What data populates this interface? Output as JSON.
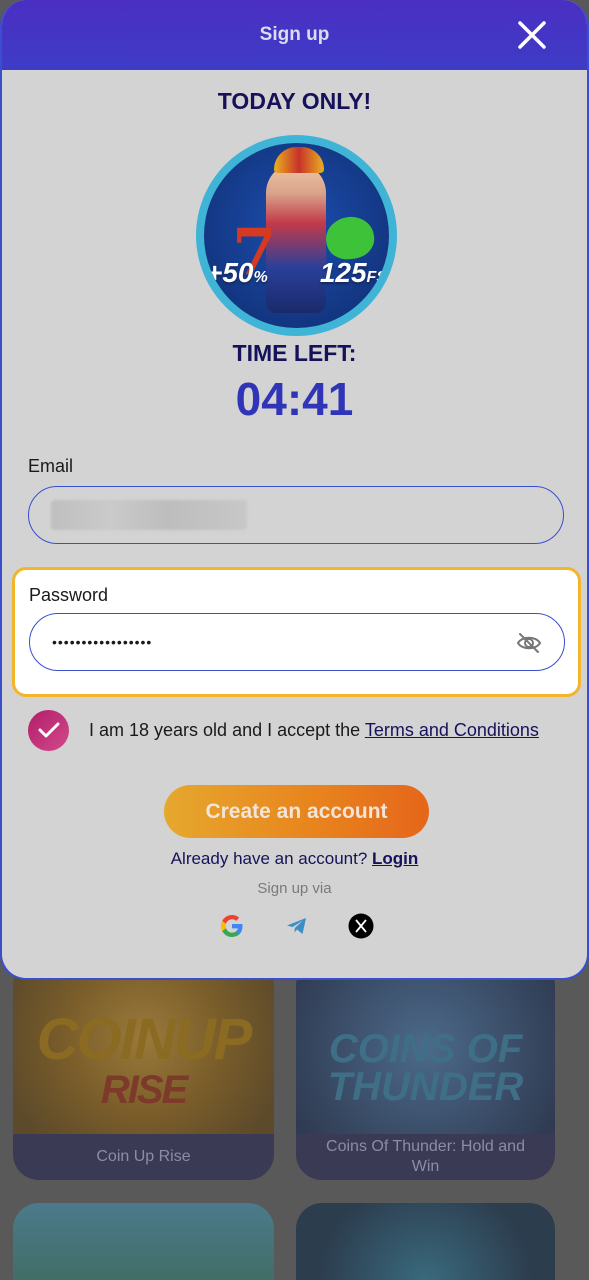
{
  "modal": {
    "title": "Sign up",
    "promo_heading": "TODAY ONLY!",
    "promo_bonus_percent": "+50",
    "promo_bonus_percent_sign": "%",
    "promo_freespins": "125",
    "promo_freespins_unit": "FS",
    "timer_label": "TIME LEFT:",
    "timer_value": "04:41",
    "email_label": "Email",
    "password_label": "Password",
    "password_value": "•••••••••••••••••",
    "terms_text": "I am 18 years old and I accept the ",
    "terms_link": "Terms and Conditions",
    "create_button": "Create an account",
    "login_prompt": "Already have an account? ",
    "login_link": "Login",
    "signup_via": "Sign up via",
    "social": [
      "google-icon",
      "telegram-icon",
      "x-icon"
    ]
  },
  "games": [
    {
      "title": "Coin Up Rise",
      "art": "COINUP",
      "art_sub": "RISE"
    },
    {
      "title": "Coins Of Thunder: Hold and Win",
      "art": "COINS OF THUNDER"
    },
    {
      "title": "",
      "art": ""
    },
    {
      "title": "",
      "art": ""
    }
  ],
  "colors": {
    "header": "#3e3cc6",
    "accent_orange": "#e8851e",
    "timer": "#3035b8",
    "checkbox": "#c02a78",
    "focus_border": "#f2b52b"
  }
}
